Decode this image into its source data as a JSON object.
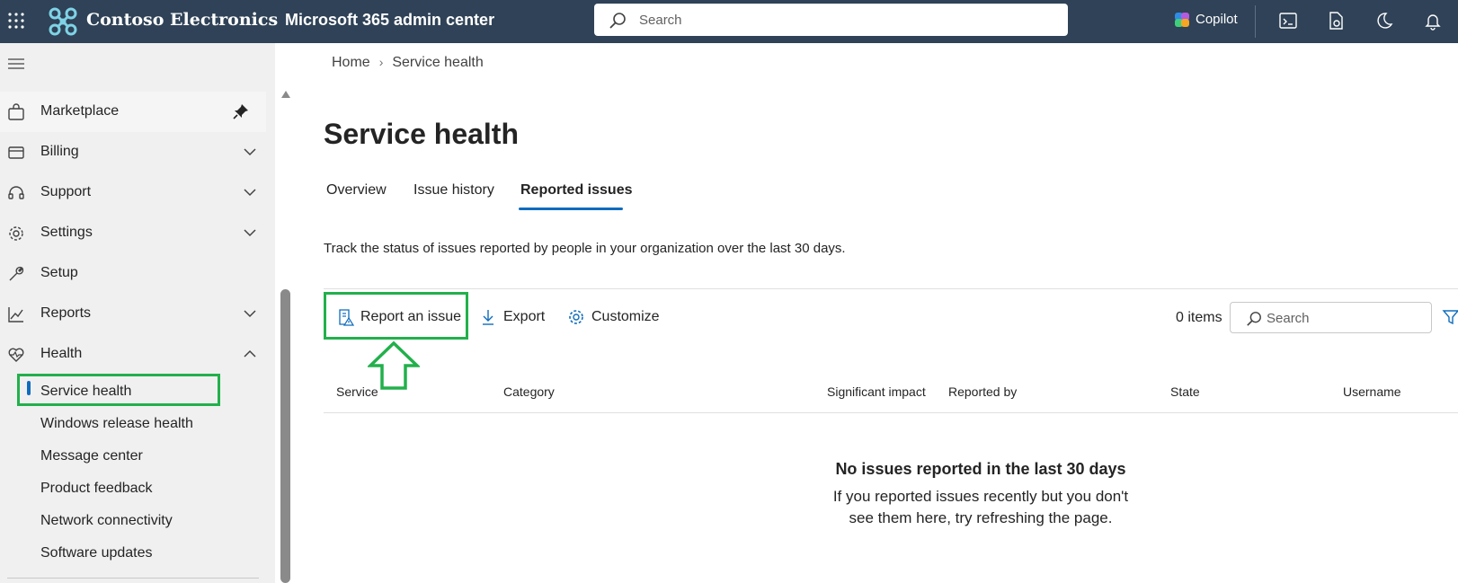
{
  "topbar": {
    "brand": "Contoso Electronics",
    "app_name": "Microsoft 365 admin center",
    "search_placeholder": "Search",
    "copilot_label": "Copilot"
  },
  "sidebar": {
    "items": [
      {
        "label": "Marketplace",
        "icon": "shopping-bag-icon",
        "pinned": true
      },
      {
        "label": "Billing",
        "icon": "billing-icon",
        "expandable": true
      },
      {
        "label": "Support",
        "icon": "headset-icon",
        "expandable": true
      },
      {
        "label": "Settings",
        "icon": "gear-icon",
        "expandable": true
      },
      {
        "label": "Setup",
        "icon": "wrench-icon"
      },
      {
        "label": "Reports",
        "icon": "chart-line-icon",
        "expandable": true
      },
      {
        "label": "Health",
        "icon": "heart-pulse-icon",
        "expanded": true
      }
    ],
    "health_children": [
      {
        "label": "Service health",
        "selected": true
      },
      {
        "label": "Windows release health"
      },
      {
        "label": "Message center"
      },
      {
        "label": "Product feedback"
      },
      {
        "label": "Network connectivity"
      },
      {
        "label": "Software updates"
      }
    ]
  },
  "main": {
    "breadcrumb": [
      "Home",
      "Service health"
    ],
    "title": "Service health",
    "tabs": [
      {
        "label": "Overview"
      },
      {
        "label": "Issue history"
      },
      {
        "label": "Reported issues",
        "selected": true
      }
    ],
    "description": "Track the status of issues reported by people in your organization over the last 30 days.",
    "commands": {
      "report": "Report an issue",
      "export": "Export",
      "customize": "Customize"
    },
    "items_count": "0 items",
    "search_placeholder": "Search",
    "columns": [
      "Service",
      "Category",
      "Significant impact",
      "Reported by",
      "State",
      "Username"
    ],
    "empty_title": "No issues reported in the last 30 days",
    "empty_text": "If you reported issues recently but you don't see them here, try refreshing the page."
  },
  "colors": {
    "topbar": "#2f4257",
    "accent": "#0f6cbd",
    "highlight": "#22b04c",
    "sidebar_bg": "#f0f0f0"
  }
}
